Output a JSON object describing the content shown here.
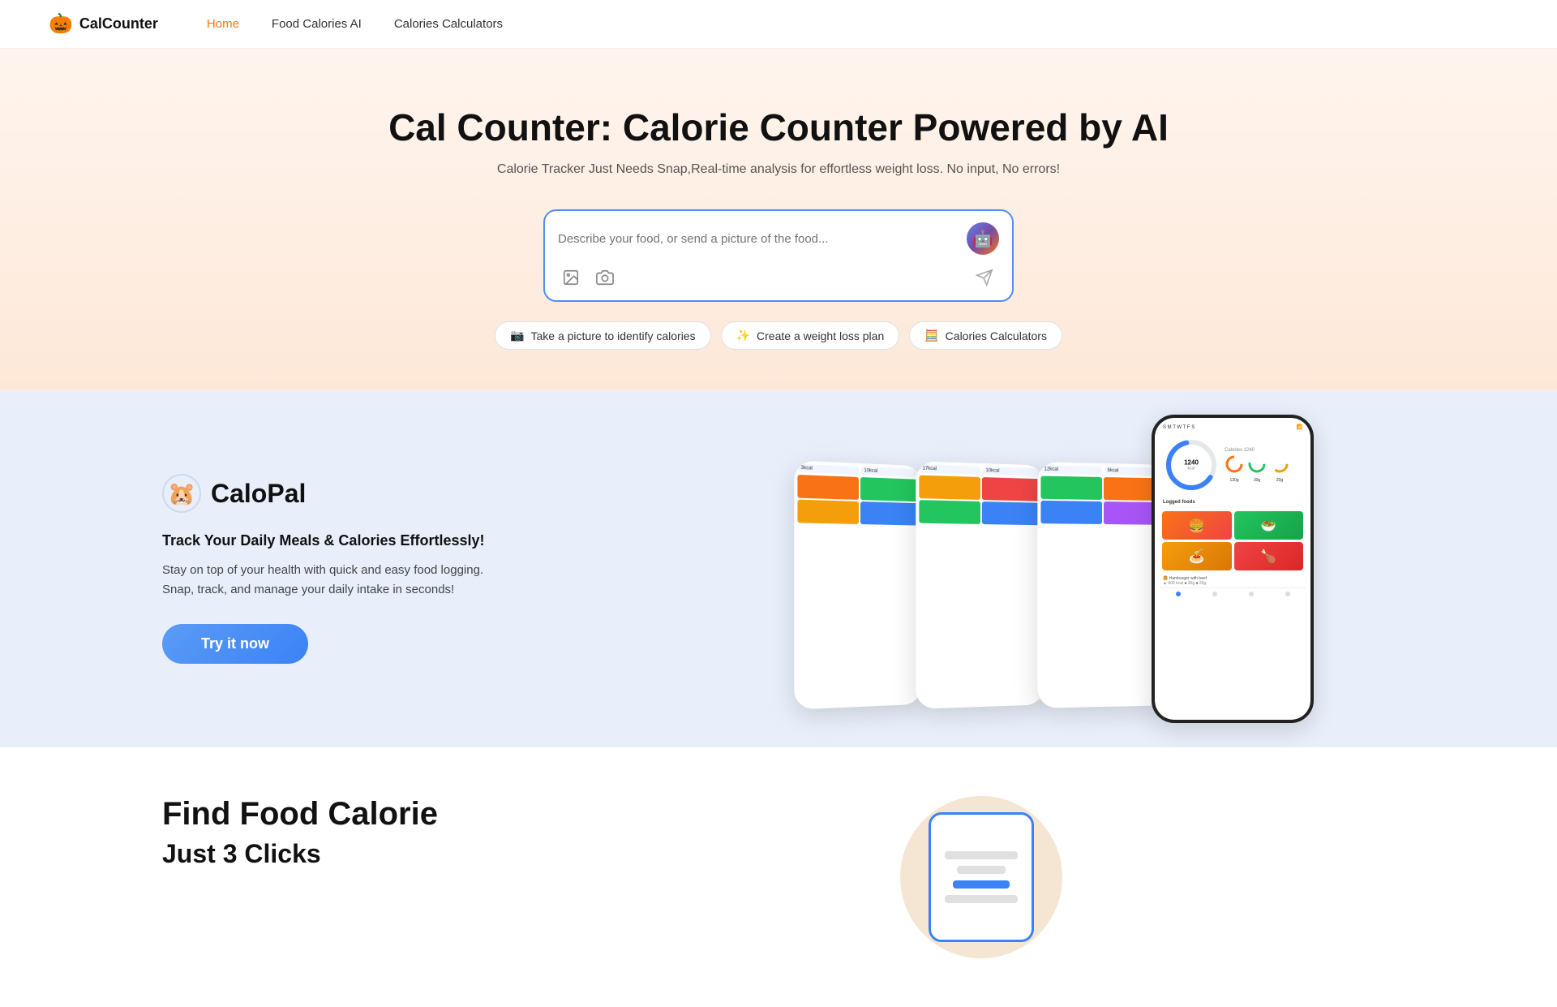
{
  "nav": {
    "logo_icon": "🎃",
    "logo_text": "CalCounter",
    "links": [
      {
        "label": "Home",
        "active": true
      },
      {
        "label": "Food Calories AI",
        "active": false
      },
      {
        "label": "Calories Calculators",
        "active": false
      }
    ]
  },
  "hero": {
    "title": "Cal Counter: Calorie Counter Powered by AI",
    "subtitle": "Calorie Tracker Just Needs Snap,Real-time analysis for effortless weight loss. No input, No errors!",
    "search_placeholder": "Describe your food, or send a picture of the food...",
    "quick_actions": [
      {
        "icon": "📷",
        "label": "Take a picture to identify calories"
      },
      {
        "icon": "✨",
        "label": "Create a weight loss plan"
      },
      {
        "icon": "🧮",
        "label": "Calories Calculators"
      }
    ]
  },
  "calopal": {
    "logo_text": "CaloPal",
    "tagline": "Track Your Daily Meals & Calories Effortlessly!",
    "description": "Stay on top of your health with quick and easy food logging. Snap, track, and manage your daily intake in seconds!",
    "cta_label": "Try it now"
  },
  "find_food": {
    "title": "Find Food Calorie",
    "subtitle": "Just 3 Clicks"
  },
  "phone_data": {
    "calories": "1240",
    "carbs": "130",
    "fat": "30",
    "protein": "20"
  }
}
